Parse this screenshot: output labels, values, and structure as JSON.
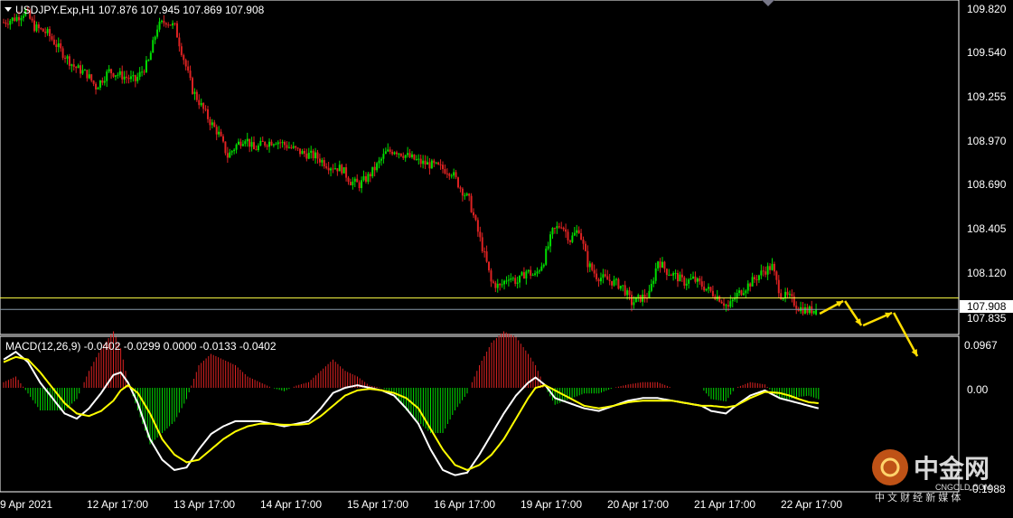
{
  "header": {
    "symbol_line": "USDJPY.Exp,H1  107.876 107.945 107.869 107.908"
  },
  "macd": {
    "label": "MACD(12,26,9) -0.0402 -0.0299 0.0000 -0.0133 -0.0402"
  },
  "price_axis": {
    "ticks": [
      "109.820",
      "109.540",
      "109.255",
      "108.970",
      "108.690",
      "108.405",
      "108.120",
      "107.835"
    ],
    "current_price": "107.908"
  },
  "macd_axis": {
    "ticks": [
      "0.0967",
      "0.00",
      "-0.1988"
    ]
  },
  "time_axis": {
    "ticks": [
      "9 Apr 2021",
      "12 Apr 17:00",
      "13 Apr 17:00",
      "14 Apr 17:00",
      "15 Apr 17:00",
      "16 Apr 17:00",
      "19 Apr 17:00",
      "20 Apr 17:00",
      "21 Apr 17:00",
      "22 Apr 17:00"
    ]
  },
  "watermark": {
    "name": "中金网",
    "domain": "CNGOLD.COM",
    "slogan": "中 文 财 经 新 媒 体"
  },
  "colors": {
    "bull": "#00dd00",
    "bear": "#dd2222",
    "macd_line": "#ffffff",
    "signal_line": "#ffff00",
    "hline": "#ffff44",
    "arrow": "#ffdd00",
    "axis": "#ffffff",
    "grid_line": "#8899aa"
  },
  "chart_data": {
    "type": "candlestick",
    "symbol": "USDJPY.Exp",
    "timeframe": "H1",
    "last_ohlc": {
      "open": 107.876,
      "high": 107.945,
      "low": 107.869,
      "close": 107.908
    },
    "price_ylim": [
      107.76,
      109.86
    ],
    "horizontal_line": 107.98,
    "close_path": [
      [
        0,
        109.73
      ],
      [
        6,
        109.76
      ],
      [
        10,
        109.8
      ],
      [
        14,
        109.7
      ],
      [
        20,
        109.66
      ],
      [
        26,
        109.55
      ],
      [
        32,
        109.45
      ],
      [
        38,
        109.4
      ],
      [
        42,
        109.32
      ],
      [
        48,
        109.42
      ],
      [
        52,
        109.4
      ],
      [
        56,
        109.38
      ],
      [
        60,
        109.36
      ],
      [
        66,
        109.48
      ],
      [
        70,
        109.7
      ],
      [
        74,
        109.74
      ],
      [
        78,
        109.7
      ],
      [
        82,
        109.5
      ],
      [
        86,
        109.3
      ],
      [
        90,
        109.2
      ],
      [
        94,
        109.1
      ],
      [
        98,
        109.02
      ],
      [
        102,
        108.88
      ],
      [
        106,
        108.95
      ],
      [
        110,
        109.0
      ],
      [
        114,
        108.92
      ],
      [
        118,
        108.96
      ],
      [
        124,
        108.98
      ],
      [
        130,
        108.94
      ],
      [
        136,
        108.9
      ],
      [
        142,
        108.88
      ],
      [
        148,
        108.82
      ],
      [
        154,
        108.8
      ],
      [
        158,
        108.72
      ],
      [
        162,
        108.7
      ],
      [
        166,
        108.75
      ],
      [
        170,
        108.82
      ],
      [
        174,
        108.9
      ],
      [
        178,
        108.92
      ],
      [
        184,
        108.88
      ],
      [
        190,
        108.84
      ],
      [
        196,
        108.82
      ],
      [
        200,
        108.8
      ],
      [
        204,
        108.78
      ],
      [
        208,
        108.68
      ],
      [
        212,
        108.6
      ],
      [
        216,
        108.4
      ],
      [
        220,
        108.2
      ],
      [
        222,
        108.08
      ],
      [
        226,
        108.05
      ],
      [
        230,
        108.12
      ],
      [
        234,
        108.08
      ],
      [
        238,
        108.15
      ],
      [
        242,
        108.12
      ],
      [
        246,
        108.22
      ],
      [
        250,
        108.4
      ],
      [
        254,
        108.45
      ],
      [
        258,
        108.35
      ],
      [
        262,
        108.42
      ],
      [
        266,
        108.2
      ],
      [
        270,
        108.12
      ],
      [
        274,
        108.1
      ],
      [
        278,
        108.08
      ],
      [
        282,
        108.05
      ],
      [
        286,
        107.95
      ],
      [
        290,
        107.98
      ],
      [
        294,
        108.0
      ],
      [
        298,
        108.22
      ],
      [
        302,
        108.15
      ],
      [
        306,
        108.12
      ],
      [
        310,
        108.08
      ],
      [
        314,
        108.1
      ],
      [
        318,
        108.06
      ],
      [
        322,
        108.02
      ],
      [
        326,
        107.98
      ],
      [
        330,
        107.92
      ],
      [
        334,
        108.0
      ],
      [
        338,
        108.05
      ],
      [
        342,
        108.1
      ],
      [
        346,
        108.15
      ],
      [
        350,
        108.18
      ],
      [
        352,
        108.08
      ],
      [
        354,
        108.0
      ],
      [
        358,
        107.98
      ],
      [
        362,
        107.92
      ],
      [
        366,
        107.9
      ],
      [
        370,
        107.908
      ]
    ],
    "macd_ylim": [
      -0.1988,
      0.0967
    ],
    "macd_path": [
      [
        0,
        0.055
      ],
      [
        5,
        0.07
      ],
      [
        10,
        0.05
      ],
      [
        15,
        0.01
      ],
      [
        20,
        -0.02
      ],
      [
        25,
        -0.05
      ],
      [
        30,
        -0.06
      ],
      [
        35,
        -0.04
      ],
      [
        40,
        -0.01
      ],
      [
        45,
        0.025
      ],
      [
        48,
        0.03
      ],
      [
        51,
        0.01
      ],
      [
        55,
        -0.03
      ],
      [
        60,
        -0.1
      ],
      [
        65,
        -0.14
      ],
      [
        70,
        -0.16
      ],
      [
        75,
        -0.155
      ],
      [
        80,
        -0.12
      ],
      [
        85,
        -0.09
      ],
      [
        90,
        -0.075
      ],
      [
        95,
        -0.065
      ],
      [
        100,
        -0.065
      ],
      [
        105,
        -0.065
      ],
      [
        110,
        -0.07
      ],
      [
        115,
        -0.075
      ],
      [
        120,
        -0.07
      ],
      [
        125,
        -0.065
      ],
      [
        130,
        -0.04
      ],
      [
        135,
        -0.01
      ],
      [
        140,
        0.0
      ],
      [
        145,
        0.005
      ],
      [
        150,
        0.0
      ],
      [
        155,
        -0.005
      ],
      [
        160,
        -0.015
      ],
      [
        165,
        -0.04
      ],
      [
        170,
        -0.07
      ],
      [
        175,
        -0.12
      ],
      [
        180,
        -0.16
      ],
      [
        185,
        -0.17
      ],
      [
        190,
        -0.165
      ],
      [
        195,
        -0.13
      ],
      [
        200,
        -0.09
      ],
      [
        205,
        -0.05
      ],
      [
        210,
        -0.015
      ],
      [
        215,
        0.01
      ],
      [
        218,
        0.02
      ],
      [
        222,
        0.005
      ],
      [
        226,
        -0.02
      ],
      [
        232,
        -0.03
      ],
      [
        238,
        -0.04
      ],
      [
        244,
        -0.045
      ],
      [
        250,
        -0.035
      ],
      [
        256,
        -0.025
      ],
      [
        262,
        -0.02
      ],
      [
        268,
        -0.02
      ],
      [
        274,
        -0.025
      ],
      [
        280,
        -0.03
      ],
      [
        286,
        -0.035
      ],
      [
        290,
        -0.045
      ],
      [
        296,
        -0.05
      ],
      [
        300,
        -0.035
      ],
      [
        306,
        -0.015
      ],
      [
        312,
        -0.005
      ],
      [
        318,
        -0.02
      ],
      [
        322,
        -0.025
      ],
      [
        326,
        -0.03
      ],
      [
        330,
        -0.035
      ],
      [
        334,
        -0.04
      ]
    ],
    "signal_path": [
      [
        0,
        0.05
      ],
      [
        5,
        0.06
      ],
      [
        10,
        0.055
      ],
      [
        15,
        0.03
      ],
      [
        20,
        0.0
      ],
      [
        25,
        -0.03
      ],
      [
        30,
        -0.05
      ],
      [
        35,
        -0.055
      ],
      [
        40,
        -0.045
      ],
      [
        45,
        -0.025
      ],
      [
        48,
        -0.005
      ],
      [
        51,
        0.005
      ],
      [
        55,
        -0.01
      ],
      [
        60,
        -0.05
      ],
      [
        65,
        -0.1
      ],
      [
        70,
        -0.13
      ],
      [
        75,
        -0.145
      ],
      [
        80,
        -0.14
      ],
      [
        85,
        -0.12
      ],
      [
        90,
        -0.1
      ],
      [
        95,
        -0.085
      ],
      [
        100,
        -0.075
      ],
      [
        105,
        -0.07
      ],
      [
        110,
        -0.07
      ],
      [
        115,
        -0.072
      ],
      [
        120,
        -0.072
      ],
      [
        125,
        -0.07
      ],
      [
        130,
        -0.055
      ],
      [
        135,
        -0.035
      ],
      [
        140,
        -0.015
      ],
      [
        145,
        -0.005
      ],
      [
        150,
        -0.002
      ],
      [
        155,
        -0.005
      ],
      [
        160,
        -0.01
      ],
      [
        165,
        -0.02
      ],
      [
        170,
        -0.04
      ],
      [
        175,
        -0.08
      ],
      [
        180,
        -0.12
      ],
      [
        185,
        -0.15
      ],
      [
        190,
        -0.16
      ],
      [
        195,
        -0.15
      ],
      [
        200,
        -0.13
      ],
      [
        205,
        -0.1
      ],
      [
        210,
        -0.06
      ],
      [
        215,
        -0.02
      ],
      [
        218,
        0.0
      ],
      [
        222,
        0.005
      ],
      [
        226,
        -0.005
      ],
      [
        232,
        -0.02
      ],
      [
        238,
        -0.035
      ],
      [
        244,
        -0.04
      ],
      [
        250,
        -0.035
      ],
      [
        256,
        -0.028
      ],
      [
        262,
        -0.025
      ],
      [
        268,
        -0.025
      ],
      [
        274,
        -0.025
      ],
      [
        280,
        -0.03
      ],
      [
        286,
        -0.035
      ],
      [
        290,
        -0.035
      ],
      [
        296,
        -0.038
      ],
      [
        300,
        -0.035
      ],
      [
        306,
        -0.02
      ],
      [
        312,
        -0.008
      ],
      [
        318,
        -0.01
      ],
      [
        322,
        -0.015
      ],
      [
        326,
        -0.022
      ],
      [
        330,
        -0.028
      ],
      [
        334,
        -0.0299
      ]
    ]
  }
}
